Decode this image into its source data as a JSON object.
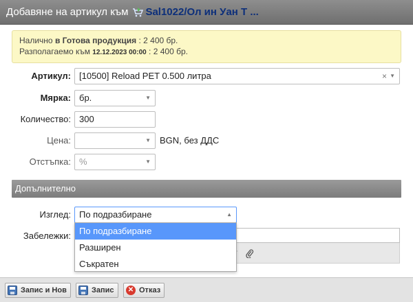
{
  "titlebar": {
    "label": "Добавяне на артикул към",
    "link": "Sal1022/Ол ин Уан Т ...",
    "icon": "cart-arrow-icon"
  },
  "info": {
    "line1_prefix": "Налично",
    "line1_bold": "в Готова продукция",
    "line1_value": ": 2 400 бр.",
    "line2_prefix": "Разполагаемо към",
    "line2_date": "12.12.2023 00:00",
    "line2_value": ": 2 400 бр."
  },
  "form": {
    "article_label": "Артикул:",
    "article_value": "[10500] Reload PET 0.500 литра",
    "unit_label": "Мярка:",
    "unit_value": "бр.",
    "quantity_label": "Количество:",
    "quantity_value": "300",
    "price_label": "Цена:",
    "price_value": "",
    "price_suffix": "BGN, без ДДС",
    "discount_label": "Отстъпка:",
    "discount_placeholder": "%"
  },
  "additional": {
    "title": "Допълнително",
    "view_label": "Изглед:",
    "view_value": "По подразбиране",
    "notes_label": "Забележки:",
    "view_options": [
      "По подразбиране",
      "Разширен",
      "Съкратен"
    ]
  },
  "footer": {
    "save_new": "Запис и Нов",
    "save": "Запис",
    "cancel": "Отказ"
  }
}
